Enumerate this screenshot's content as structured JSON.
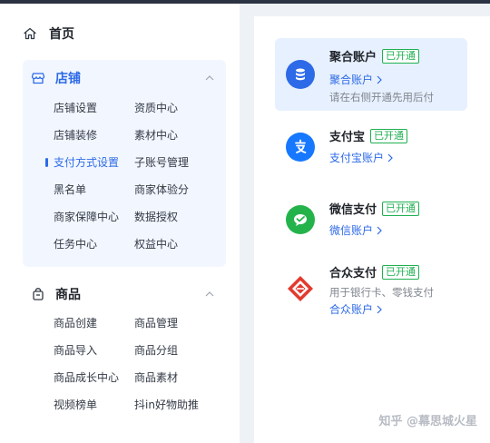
{
  "sidebar": {
    "home_label": "首页",
    "store": {
      "title": "店铺",
      "items": [
        "店铺设置",
        "资质中心",
        "店铺装修",
        "素材中心",
        "支付方式设置",
        "子账号管理",
        "黑名单",
        "商家体验分",
        "商家保障中心",
        "数据授权",
        "任务中心",
        "权益中心"
      ],
      "active_item": "支付方式设置"
    },
    "goods": {
      "title": "商品",
      "items": [
        "商品创建",
        "商品管理",
        "商品导入",
        "商品分组",
        "商品成长中心",
        "商品素材",
        "视频榜单",
        "抖in好物助推"
      ]
    }
  },
  "payments": [
    {
      "name": "聚合账户",
      "badge": "已开通",
      "link": "聚合账户",
      "desc": "请在右侧开通先用后付",
      "selected": true
    },
    {
      "name": "支付宝",
      "badge": "已开通",
      "link": "支付宝账户"
    },
    {
      "name": "微信支付",
      "badge": "已开通",
      "link": "微信账户"
    },
    {
      "name": "合众支付",
      "badge": "已开通",
      "desc": "用于银行卡、零钱支付",
      "link": "合众账户"
    }
  ],
  "watermark": "知乎 @幕思城火星",
  "colors": {
    "accent": "#2d6ae8",
    "success": "#1fb050",
    "selected_bg": "#e7f0fe"
  }
}
